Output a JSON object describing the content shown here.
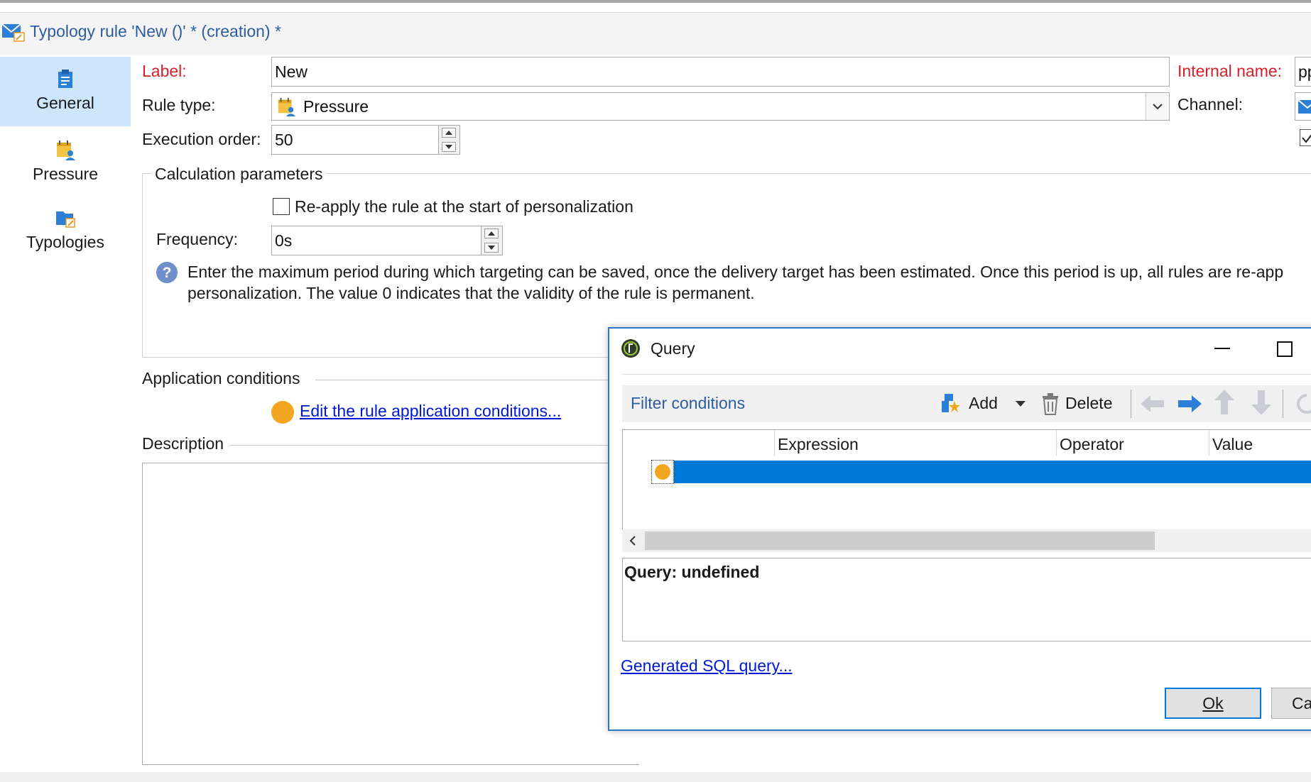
{
  "window": {
    "title": "Typology rule 'New ()' * (creation) *"
  },
  "sidebar": {
    "items": [
      {
        "label": "General",
        "icon": "clipboard-icon",
        "active": true
      },
      {
        "label": "Pressure",
        "icon": "calendar-user-icon",
        "active": false
      },
      {
        "label": "Typologies",
        "icon": "folder-typology-icon",
        "active": false
      }
    ]
  },
  "form": {
    "label_caption": "Label:",
    "label_value": "New",
    "internal_name_caption": "Internal name:",
    "internal_name_value": "pp",
    "rule_type_caption": "Rule type:",
    "rule_type_value": "Pressure",
    "channel_caption": "Channel:",
    "execution_order_caption": "Execution order:",
    "execution_order_value": "50"
  },
  "calc": {
    "legend": "Calculation parameters",
    "reapply_label": "Re-apply the rule at the start of personalization",
    "reapply_checked": false,
    "frequency_caption": "Frequency:",
    "frequency_value": "0s",
    "help_line1": "Enter the maximum period during which targeting can be saved, once the delivery target has been estimated. Once this period is up, all rules are re-app",
    "help_line2": "personalization. The value 0 indicates that the validity of the rule is permanent."
  },
  "conditions": {
    "legend": "Application conditions",
    "edit_link": "Edit the rule application conditions..."
  },
  "description": {
    "legend": "Description"
  },
  "dialog": {
    "title": "Query",
    "toolbar": {
      "filter_label": "Filter conditions",
      "add_label": "Add",
      "delete_label": "Delete"
    },
    "grid": {
      "columns": [
        "Expression",
        "Operator",
        "Value"
      ]
    },
    "query_text": "Query: undefined",
    "sql_link": "Generated SQL query...",
    "ok_label": "Ok",
    "cancel_label": "Ca"
  },
  "colors": {
    "accent": "#0078d7",
    "link": "#0018d6",
    "required": "#d8202a",
    "condition_dot": "#f2a51e",
    "sidebar_active": "#cde6fb"
  }
}
